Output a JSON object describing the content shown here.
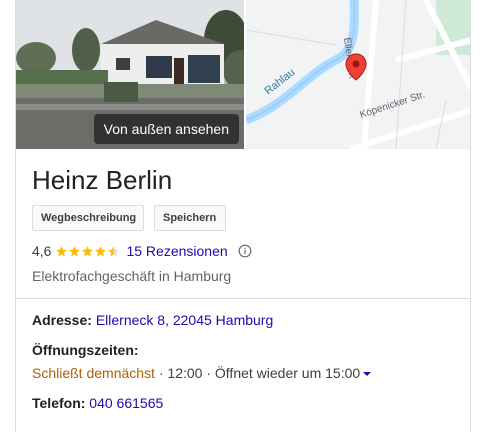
{
  "business": {
    "name": "Heinz Berlin",
    "category": "Elektrofachgeschäft in Hamburg"
  },
  "photo": {
    "button_label": "Von außen ansehen"
  },
  "map": {
    "street_labels": [
      "Rahlau",
      "Ellerneck",
      "Köpenicker Str."
    ],
    "marker_color": "#ea4335"
  },
  "actions": {
    "directions_label": "Wegbeschreibung",
    "save_label": "Speichern"
  },
  "rating": {
    "value": "4,6",
    "stars": 4.5,
    "reviews_label": "15 Rezensionen"
  },
  "details": {
    "address_label": "Adresse:",
    "address_value": "Ellerneck 8, 22045 Hamburg",
    "hours_label": "Öffnungszeiten:",
    "hours_status": "Schließt demnächst",
    "hours_sep": "·",
    "hours_close_time": "12:00",
    "hours_reopen": "Öffnet wieder um 15:00",
    "phone_label": "Telefon:",
    "phone_value": "040 661565"
  },
  "colors": {
    "link": "#1a0dab",
    "star": "#fbbc04",
    "status_orange": "#b06000",
    "border": "#dadce0"
  }
}
